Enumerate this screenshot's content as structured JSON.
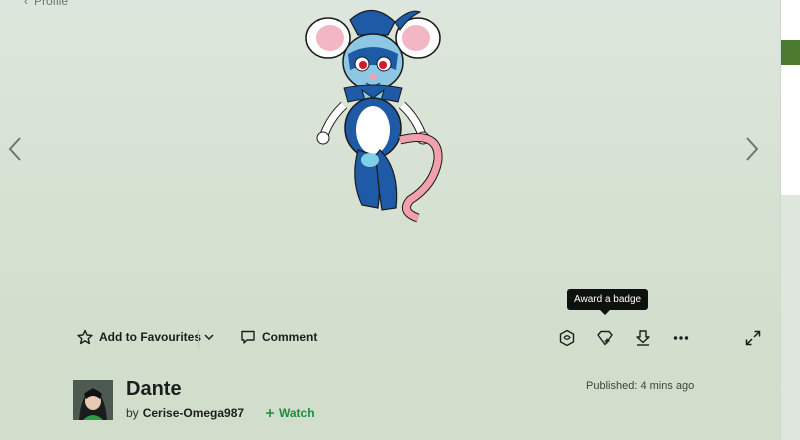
{
  "breadcrumb": {
    "label": "Profile"
  },
  "actions": {
    "favourite_label": "Add to Favourites",
    "comment_label": "Comment"
  },
  "tooltip": {
    "text": "Award a badge"
  },
  "deviation": {
    "title": "Dante",
    "by_prefix": "by",
    "author": "Cerise-Omega987",
    "watch_label": "Watch",
    "published_label": "Published:",
    "published_time": "4 mins ago"
  },
  "icons": {
    "back": "chevron-left-icon",
    "prev": "chevron-left-icon",
    "next": "chevron-right-icon",
    "favourite": "star-icon",
    "dropdown": "chevron-down-icon",
    "comment": "comment-bubble-icon",
    "badge": "badge-icon",
    "award": "award-badge-icon",
    "download": "download-icon",
    "more": "more-dots-icon",
    "expand": "expand-icon",
    "watch": "plus-icon"
  },
  "colors": {
    "background": "#d6e1d3",
    "watch_green": "#1f8a3d",
    "tooltip_bg": "#0e120f"
  }
}
